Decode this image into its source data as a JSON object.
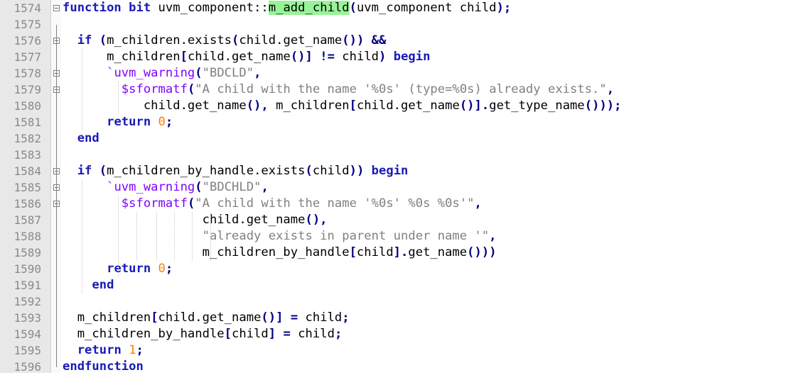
{
  "editor": {
    "lines": [
      {
        "num": "1574",
        "fold": "open",
        "tokens": [
          {
            "t": "function",
            "c": "kw"
          },
          {
            "t": " bit ",
            "c": "kw"
          },
          {
            "t": "uvm_component::",
            "c": "id"
          },
          {
            "t": "m_add_child",
            "c": "id hl"
          },
          {
            "t": "(",
            "c": "op"
          },
          {
            "t": "uvm_component child",
            "c": "id"
          },
          {
            "t": ");",
            "c": "op"
          }
        ]
      },
      {
        "num": "1575",
        "fold": "",
        "tokens": []
      },
      {
        "num": "1576",
        "fold": "open",
        "tokens": [
          {
            "t": "  ",
            "c": "id"
          },
          {
            "t": "if",
            "c": "kw"
          },
          {
            "t": " (",
            "c": "op"
          },
          {
            "t": "m_children.exists",
            "c": "id"
          },
          {
            "t": "(",
            "c": "op"
          },
          {
            "t": "child.get_name",
            "c": "id"
          },
          {
            "t": "())",
            "c": "op"
          },
          {
            "t": " ",
            "c": "id"
          },
          {
            "t": "&&",
            "c": "op"
          }
        ]
      },
      {
        "num": "1577",
        "fold": "",
        "tokens": [
          {
            "t": "      m_children",
            "c": "id"
          },
          {
            "t": "[",
            "c": "op"
          },
          {
            "t": "child.get_name",
            "c": "id"
          },
          {
            "t": "()]",
            "c": "op"
          },
          {
            "t": " ",
            "c": "id"
          },
          {
            "t": "!=",
            "c": "op"
          },
          {
            "t": " child",
            "c": "id"
          },
          {
            "t": ")",
            "c": "op"
          },
          {
            "t": " begin",
            "c": "kw"
          }
        ]
      },
      {
        "num": "1578",
        "fold": "open",
        "tokens": [
          {
            "t": "      ",
            "c": "id"
          },
          {
            "t": "`uvm_warning",
            "c": "sys"
          },
          {
            "t": "(",
            "c": "op"
          },
          {
            "t": "\"BDCLD\"",
            "c": "str"
          },
          {
            "t": ",",
            "c": "op"
          }
        ]
      },
      {
        "num": "1579",
        "fold": "open",
        "tokens": [
          {
            "t": "        ",
            "c": "id"
          },
          {
            "t": "$sformatf",
            "c": "sys"
          },
          {
            "t": "(",
            "c": "op"
          },
          {
            "t": "\"A child with the name '%0s' (type=%0s) already exists.\"",
            "c": "str"
          },
          {
            "t": ",",
            "c": "op"
          }
        ]
      },
      {
        "num": "1580",
        "fold": "end",
        "tokens": [
          {
            "t": "           child.get_name",
            "c": "id"
          },
          {
            "t": "(),",
            "c": "op"
          },
          {
            "t": " m_children",
            "c": "id"
          },
          {
            "t": "[",
            "c": "op"
          },
          {
            "t": "child.get_name",
            "c": "id"
          },
          {
            "t": "()].",
            "c": "op"
          },
          {
            "t": "get_type_name",
            "c": "id"
          },
          {
            "t": "()));",
            "c": "op"
          }
        ]
      },
      {
        "num": "1581",
        "fold": "",
        "tokens": [
          {
            "t": "      ",
            "c": "id"
          },
          {
            "t": "return",
            "c": "kw"
          },
          {
            "t": " ",
            "c": "id"
          },
          {
            "t": "0",
            "c": "num"
          },
          {
            "t": ";",
            "c": "op"
          }
        ]
      },
      {
        "num": "1582",
        "fold": "end",
        "tokens": [
          {
            "t": "  ",
            "c": "id"
          },
          {
            "t": "end",
            "c": "kw"
          }
        ]
      },
      {
        "num": "1583",
        "fold": "",
        "tokens": []
      },
      {
        "num": "1584",
        "fold": "open",
        "tokens": [
          {
            "t": "  ",
            "c": "id"
          },
          {
            "t": "if",
            "c": "kw"
          },
          {
            "t": " (",
            "c": "op"
          },
          {
            "t": "m_children_by_handle.exists",
            "c": "id"
          },
          {
            "t": "(",
            "c": "op"
          },
          {
            "t": "child",
            "c": "id"
          },
          {
            "t": "))",
            "c": "op"
          },
          {
            "t": " begin",
            "c": "kw"
          }
        ]
      },
      {
        "num": "1585",
        "fold": "open",
        "tokens": [
          {
            "t": "      ",
            "c": "id"
          },
          {
            "t": "`uvm_warning",
            "c": "sys"
          },
          {
            "t": "(",
            "c": "op"
          },
          {
            "t": "\"BDCHLD\"",
            "c": "str"
          },
          {
            "t": ",",
            "c": "op"
          }
        ]
      },
      {
        "num": "1586",
        "fold": "open",
        "tokens": [
          {
            "t": "        ",
            "c": "id"
          },
          {
            "t": "$sformatf",
            "c": "sys"
          },
          {
            "t": "(",
            "c": "op"
          },
          {
            "t": "\"A child with the name '%0s' %0s %0s'\"",
            "c": "str"
          },
          {
            "t": ",",
            "c": "op"
          }
        ]
      },
      {
        "num": "1587",
        "fold": "",
        "tokens": [
          {
            "t": "                   child.get_name",
            "c": "id"
          },
          {
            "t": "(),",
            "c": "op"
          }
        ]
      },
      {
        "num": "1588",
        "fold": "",
        "tokens": [
          {
            "t": "                   ",
            "c": "id"
          },
          {
            "t": "\"already exists in parent under name '\"",
            "c": "str"
          },
          {
            "t": ",",
            "c": "op"
          }
        ]
      },
      {
        "num": "1589",
        "fold": "",
        "tokens": [
          {
            "t": "                   m_children_by_handle",
            "c": "id"
          },
          {
            "t": "[",
            "c": "op"
          },
          {
            "t": "child",
            "c": "id"
          },
          {
            "t": "].",
            "c": "op"
          },
          {
            "t": "get_name",
            "c": "id"
          },
          {
            "t": "()))",
            "c": "op"
          }
        ]
      },
      {
        "num": "1590",
        "fold": "",
        "tokens": [
          {
            "t": "      ",
            "c": "id"
          },
          {
            "t": "return",
            "c": "kw"
          },
          {
            "t": " ",
            "c": "id"
          },
          {
            "t": "0",
            "c": "num"
          },
          {
            "t": ";",
            "c": "op"
          }
        ]
      },
      {
        "num": "1591",
        "fold": "end",
        "tokens": [
          {
            "t": "    ",
            "c": "id"
          },
          {
            "t": "end",
            "c": "kw"
          }
        ]
      },
      {
        "num": "1592",
        "fold": "",
        "tokens": []
      },
      {
        "num": "1593",
        "fold": "",
        "tokens": [
          {
            "t": "  m_children",
            "c": "id"
          },
          {
            "t": "[",
            "c": "op"
          },
          {
            "t": "child.get_name",
            "c": "id"
          },
          {
            "t": "()]",
            "c": "op"
          },
          {
            "t": " ",
            "c": "id"
          },
          {
            "t": "=",
            "c": "op"
          },
          {
            "t": " child",
            "c": "id"
          },
          {
            "t": ";",
            "c": "op"
          }
        ]
      },
      {
        "num": "1594",
        "fold": "",
        "tokens": [
          {
            "t": "  m_children_by_handle",
            "c": "id"
          },
          {
            "t": "[",
            "c": "op"
          },
          {
            "t": "child",
            "c": "id"
          },
          {
            "t": "]",
            "c": "op"
          },
          {
            "t": " ",
            "c": "id"
          },
          {
            "t": "=",
            "c": "op"
          },
          {
            "t": " child",
            "c": "id"
          },
          {
            "t": ";",
            "c": "op"
          }
        ]
      },
      {
        "num": "1595",
        "fold": "",
        "tokens": [
          {
            "t": "  ",
            "c": "id"
          },
          {
            "t": "return",
            "c": "kw"
          },
          {
            "t": " ",
            "c": "id"
          },
          {
            "t": "1",
            "c": "num"
          },
          {
            "t": ";",
            "c": "op"
          }
        ]
      },
      {
        "num": "1596",
        "fold": "end",
        "tokens": [
          {
            "t": "endfunction",
            "c": "kw"
          }
        ]
      }
    ]
  }
}
